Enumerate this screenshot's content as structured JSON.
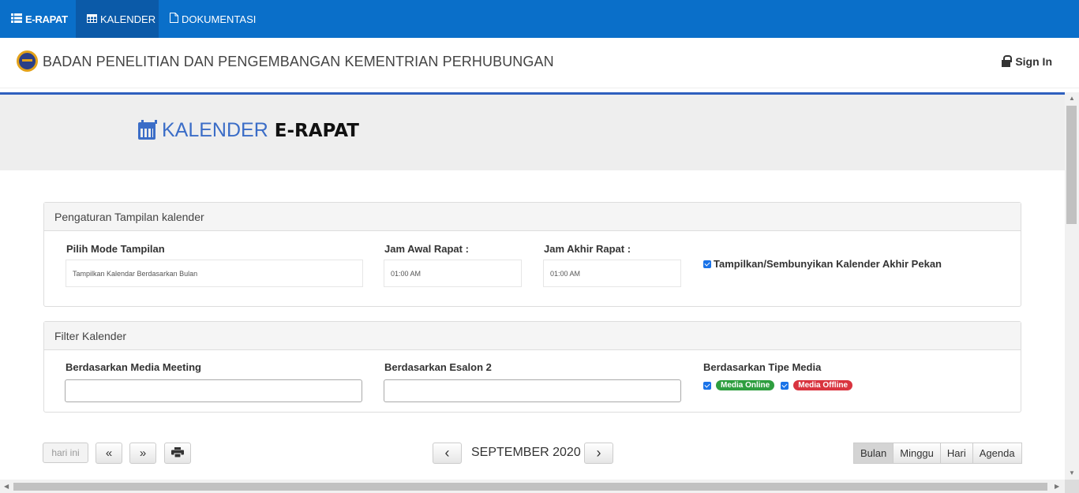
{
  "topnav": {
    "brand": "E-RAPAT",
    "items": [
      {
        "label": "KALENDER",
        "active": true
      },
      {
        "label": "DOKUMENTASI",
        "active": false
      }
    ]
  },
  "header": {
    "title": "BADAN PENELITIAN DAN PENGEMBANGAN KEMENTRIAN PERHUBUNGAN",
    "signin": "Sign In"
  },
  "page": {
    "title_light": "KALENDER",
    "title_bold": "E-RAPAT"
  },
  "settings_panel": {
    "heading": "Pengaturan Tampilan kalender",
    "mode_label": "Pilih Mode Tampilan",
    "mode_value": "Tampilkan Kalendar Berdasarkan Bulan",
    "start_label": "Jam Awal Rapat :",
    "start_value": "01:00 AM",
    "end_label": "Jam Akhir Rapat :",
    "end_value": "01:00 AM",
    "weekend_label": "Tampilkan/Sembunyikan Kalender Akhir Pekan",
    "weekend_checked": true
  },
  "filter_panel": {
    "heading": "Filter Kalender",
    "media_meeting_label": "Berdasarkan Media Meeting",
    "esalon_label": "Berdasarkan Esalon 2",
    "tipe_media_label": "Berdasarkan Tipe Media",
    "online_label": "Media Online",
    "offline_label": "Media Offline",
    "online_color": "#2e9e3f",
    "offline_color": "#d9343f"
  },
  "toolbar": {
    "today": "hari ini",
    "prev_year": "«",
    "next_year": "»",
    "month": "SEPTEMBER 2020",
    "prev": "‹",
    "next": "›",
    "views": [
      "Bulan",
      "Minggu",
      "Hari",
      "Agenda"
    ],
    "active_view": "Bulan"
  },
  "colors": {
    "nav_bg": "#0a6fc9",
    "title_blue": "#3b6dc7"
  }
}
